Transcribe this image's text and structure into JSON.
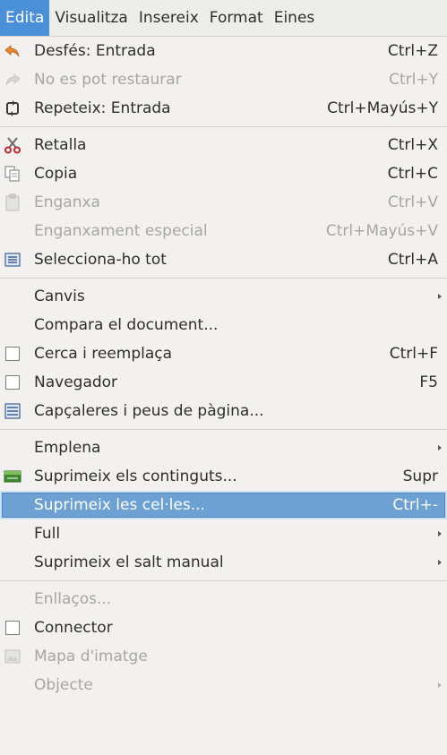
{
  "menubar": {
    "items": [
      {
        "label": "Edita",
        "mnemonic": "E"
      },
      {
        "label": "Visualitza",
        "mnemonic": "V"
      },
      {
        "label": "Insereix",
        "mnemonic": "I"
      },
      {
        "label": "Format",
        "mnemonic": "o"
      },
      {
        "label": "Eines",
        "mnemonic": "n"
      }
    ]
  },
  "menu": {
    "undo": {
      "label": "Desfés: Entrada",
      "accel": "Ctrl+Z"
    },
    "redo": {
      "label": "No es pot restaurar",
      "accel": "Ctrl+Y"
    },
    "repeat": {
      "label": "Repeteix: Entrada",
      "accel": "Ctrl+Mayús+Y"
    },
    "cut": {
      "label": "Retalla",
      "accel": "Ctrl+X"
    },
    "copy": {
      "label": "Copia",
      "accel": "Ctrl+C"
    },
    "paste": {
      "label": "Enganxa",
      "accel": "Ctrl+V"
    },
    "paste_special": {
      "label": "Enganxament especial",
      "accel": "Ctrl+Mayús+V"
    },
    "select_all": {
      "label": "Selecciona-ho tot",
      "accel": "Ctrl+A"
    },
    "changes": {
      "label": "Canvis"
    },
    "compare": {
      "label": "Compara el document..."
    },
    "find_replace": {
      "label": "Cerca i reemplaça",
      "accel": "Ctrl+F"
    },
    "navigator": {
      "label": "Navegador",
      "accel": "F5"
    },
    "headers_footers": {
      "label": "Capçaleres i peus de pàgina..."
    },
    "fill": {
      "label": "Emplena"
    },
    "delete_contents": {
      "label": "Suprimeix els continguts...",
      "accel": "Supr"
    },
    "delete_cells": {
      "label": "Suprimeix les cel·les...",
      "accel": "Ctrl+-"
    },
    "sheet": {
      "label": "Full"
    },
    "delete_manual_break": {
      "label": "Suprimeix el salt manual"
    },
    "links": {
      "label": "Enllaços..."
    },
    "connector": {
      "label": "Connector"
    },
    "image_map": {
      "label": "Mapa d'imatge"
    },
    "object": {
      "label": "Objecte"
    }
  },
  "colors": {
    "menubar_active": "#4a90d9",
    "highlight": "#6ea1d3",
    "disabled_text": "#a6a6a2"
  }
}
